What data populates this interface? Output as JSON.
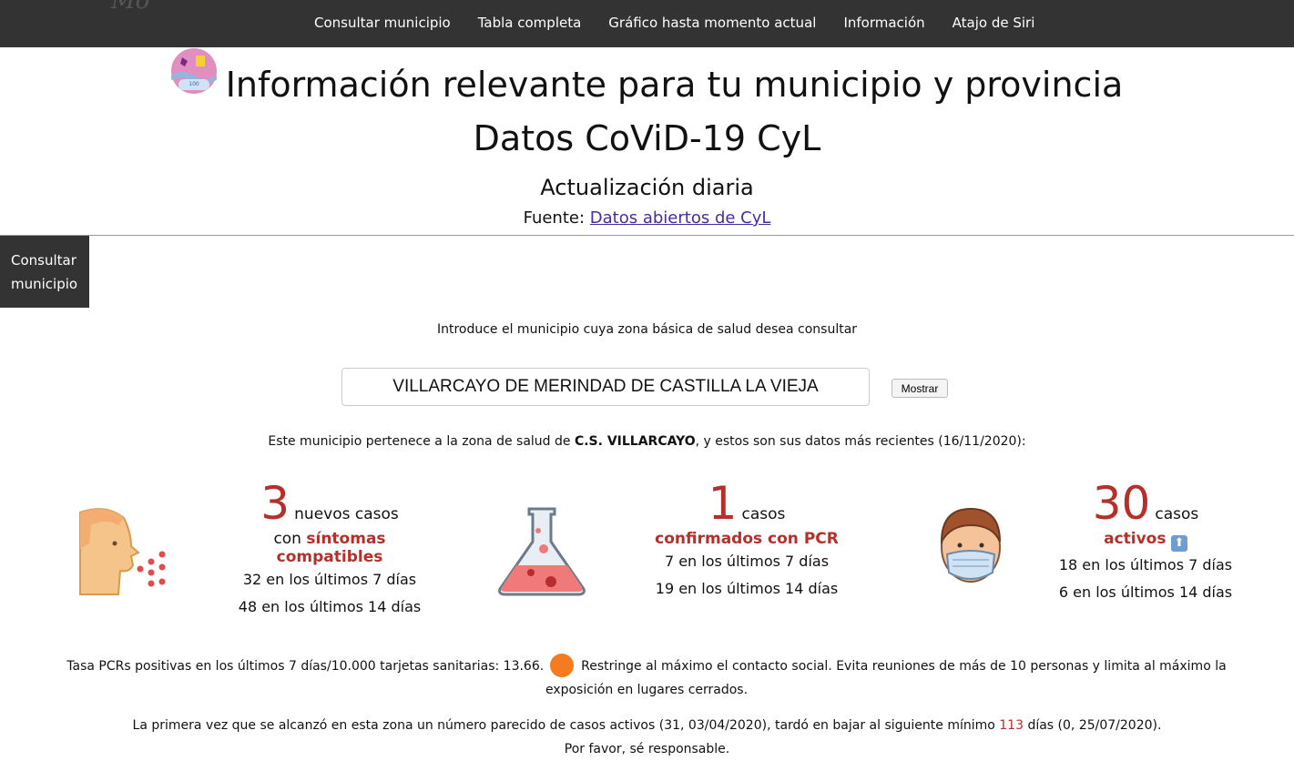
{
  "nav": {
    "logo_text": "Mo",
    "links": [
      "Consultar municipio",
      "Tabla completa",
      "Gráfico hasta momento actual",
      "Información",
      "Atajo de Siri"
    ]
  },
  "header": {
    "title": "Información relevante para tu municipio y provincia",
    "subtitle": "Datos CoViD-19 CyL",
    "update": "Actualización diaria",
    "source_label": "Fuente:",
    "source_link": "Datos abiertos de CyL"
  },
  "sidetab": {
    "line1": "Consultar",
    "line2": "municipio"
  },
  "search": {
    "prompt": "Introduce el municipio cuya zona básica de salud desea consultar",
    "value": "VILLARCAYO DE MERINDAD DE CASTILLA LA VIEJA",
    "button": "Mostrar"
  },
  "zone": {
    "before": "Este municipio pertenece a la zona de salud de ",
    "name": "C.S. VILLARCAYO",
    "after": ", y estos son sus datos más recientes (16/11/2020):"
  },
  "stats": {
    "new": {
      "num": "3",
      "unit": "nuevos casos",
      "prefix": "con ",
      "label": "síntomas compatibles",
      "sub7": "32 en los últimos 7 días",
      "sub14": "48 en los últimos 14 días"
    },
    "pcr": {
      "num": "1",
      "unit": "casos",
      "label": "confirmados con PCR",
      "sub7": "7 en los últimos 7 días",
      "sub14": "19 en los últimos 14 días"
    },
    "active": {
      "num": "30",
      "unit": "casos",
      "label": "activos",
      "sub7": "18 en los últimos 7 días",
      "sub14": "6 en los últimos 14 días",
      "trend_icon": "up-arrow-icon"
    }
  },
  "tasa": {
    "text": "Tasa PCRs positivas en los últimos 7 días/10.000 tarjetas sanitarias: 13.66.",
    "level_color": "#f47b20",
    "advice": "Restringe al máximo el contacto social. Evita reuniones de más de 10 personas y limita al máximo la exposición en lugares cerrados."
  },
  "first": {
    "before": "La primera vez que se alcanzó en esta zona un número parecido de casos activos (31, 03/04/2020), tardó en bajar al siguiente mínimo ",
    "days": "113",
    "after": " días (0, 25/07/2020).",
    "closing": "Por favor, sé responsable."
  }
}
